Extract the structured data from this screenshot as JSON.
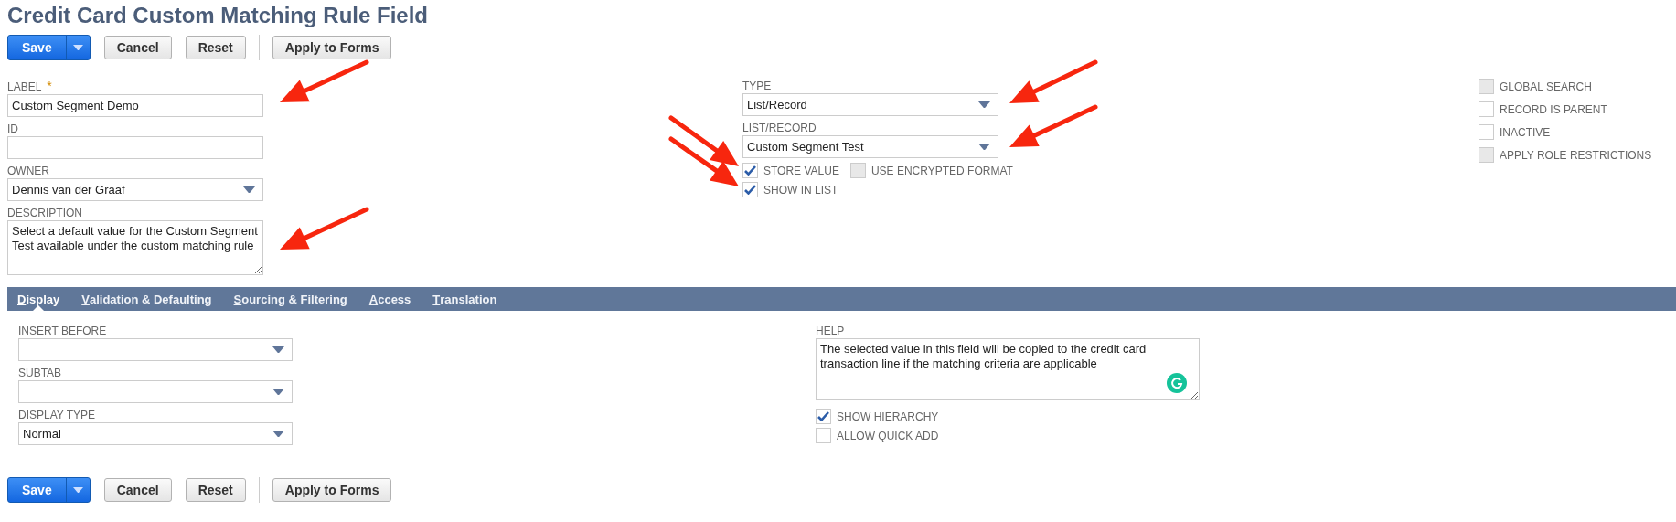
{
  "page_title": "Credit Card Custom Matching Rule Field",
  "top_toolbar": {
    "button_groups": [
      [
        {
          "label": "Save",
          "kind": "primary"
        },
        {
          "label": "Cancel",
          "kind": "default"
        },
        {
          "label": "Reset",
          "kind": "default"
        }
      ],
      [
        {
          "label": "Apply to Forms",
          "kind": "default"
        }
      ]
    ]
  },
  "main_columns": [
    {
      "items": [
        {
          "kind": "text",
          "label": "LABEL",
          "required_mark": "*",
          "value": "Custom Segment Demo"
        },
        {
          "kind": "text",
          "label": "ID"
        },
        {
          "kind": "select",
          "label": "OWNER",
          "value": "Dennis van der Graaf"
        },
        {
          "kind": "textarea",
          "label": "DESCRIPTION",
          "value": "Select a default value for the Custom Segment Test available under the custom matching rule"
        }
      ]
    },
    {
      "items": [
        {
          "kind": "select",
          "label": "TYPE",
          "value": "List/Record"
        },
        {
          "kind": "select",
          "label": "LIST/RECORD",
          "value": "Custom Segment Test"
        },
        {
          "kind": "checkbox_row",
          "checkboxes": [
            {
              "label": "STORE VALUE",
              "checked": true,
              "disabled": false
            },
            {
              "label": "USE ENCRYPTED FORMAT",
              "checked": false,
              "disabled": true
            }
          ]
        },
        {
          "kind": "checkbox_row",
          "checkboxes": [
            {
              "label": "SHOW IN LIST",
              "checked": true,
              "disabled": false
            }
          ]
        }
      ]
    },
    {
      "items": [
        {
          "kind": "checkbox_row",
          "checkboxes": [
            {
              "label": "GLOBAL SEARCH",
              "checked": false,
              "disabled": true
            }
          ]
        },
        {
          "kind": "checkbox_row",
          "checkboxes": [
            {
              "label": "RECORD IS PARENT",
              "checked": false,
              "disabled": false
            }
          ]
        },
        {
          "kind": "checkbox_row",
          "checkboxes": [
            {
              "label": "INACTIVE",
              "checked": false,
              "disabled": false
            }
          ]
        },
        {
          "kind": "checkbox_row",
          "checkboxes": [
            {
              "label": "APPLY ROLE RESTRICTIONS",
              "checked": false,
              "disabled": true
            }
          ]
        }
      ]
    }
  ],
  "tabs": [
    {
      "label": "Display",
      "selected": true
    },
    {
      "label": "Validation & Defaulting",
      "selected": false
    },
    {
      "label": "Sourcing & Filtering",
      "selected": false
    },
    {
      "label": "Access",
      "selected": false
    },
    {
      "label": "Translation",
      "selected": false
    }
  ],
  "tab_columns": [
    {
      "items": [
        {
          "kind": "select",
          "label": "INSERT BEFORE"
        },
        {
          "kind": "select",
          "label": "SUBTAB"
        },
        {
          "kind": "select",
          "label": "DISPLAY TYPE",
          "value": "Normal"
        }
      ]
    },
    {
      "items": [
        {
          "kind": "textarea",
          "label": "HELP",
          "value": "The selected value in this field will be copied to the credit card transaction line if the matching criteria are applicable",
          "assistant_badge": true
        },
        {
          "kind": "checkbox_row",
          "checkboxes": [
            {
              "label": "SHOW HIERARCHY",
              "checked": true,
              "disabled": false
            }
          ]
        },
        {
          "kind": "checkbox_row",
          "checkboxes": [
            {
              "label": "ALLOW QUICK ADD",
              "checked": false,
              "disabled": false
            }
          ]
        }
      ]
    }
  ],
  "bottom_toolbar": {
    "button_groups": [
      [
        {
          "label": "Save",
          "kind": "primary"
        },
        {
          "label": "Cancel",
          "kind": "default"
        },
        {
          "label": "Reset",
          "kind": "default"
        }
      ],
      [
        {
          "label": "Apply to Forms",
          "kind": "default"
        }
      ]
    ]
  }
}
